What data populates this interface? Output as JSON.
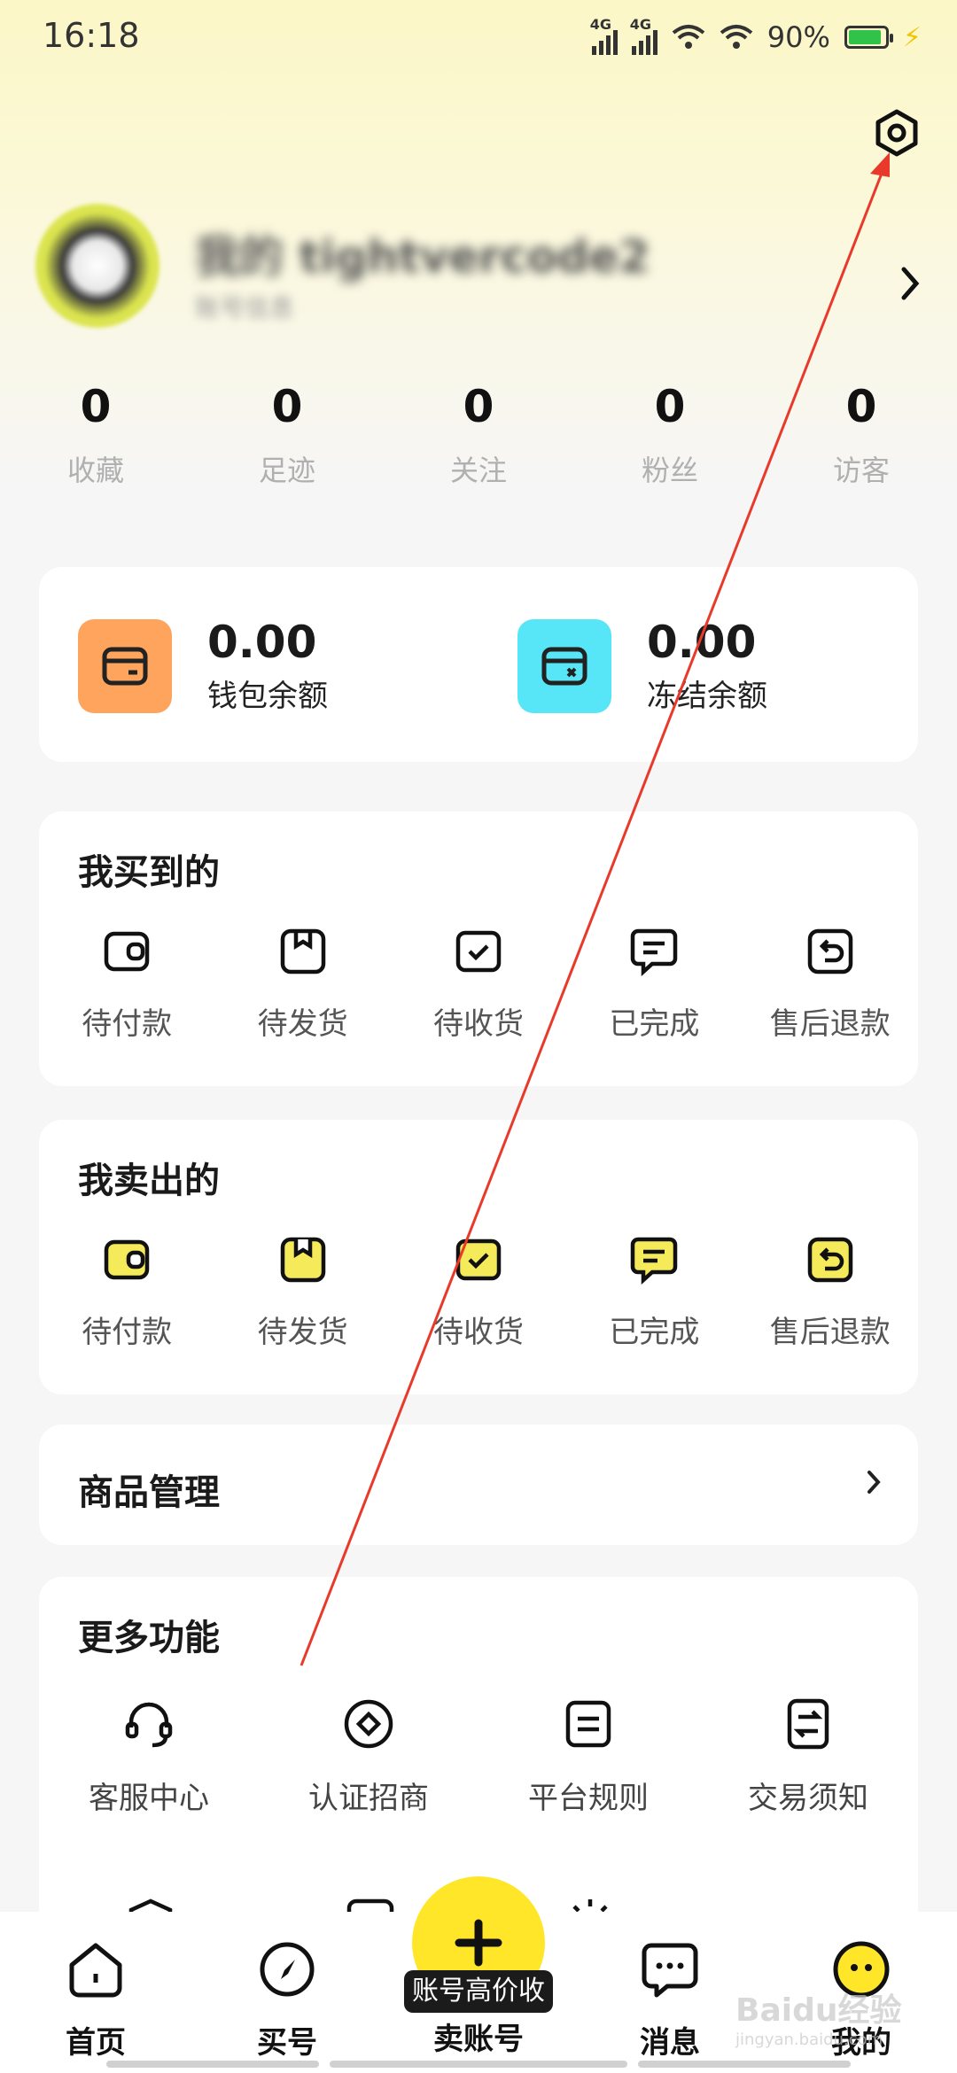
{
  "status_bar": {
    "time": "16:18",
    "battery": "90%",
    "net1": "4G",
    "net2": "4G"
  },
  "profile": {
    "username": "我的 tightvercode2",
    "subtitle": "账号信息"
  },
  "stats": [
    {
      "value": "0",
      "label": "收藏"
    },
    {
      "value": "0",
      "label": "足迹"
    },
    {
      "value": "0",
      "label": "关注"
    },
    {
      "value": "0",
      "label": "粉丝"
    },
    {
      "value": "0",
      "label": "访客"
    }
  ],
  "wallet": {
    "balance": {
      "amount": "0.00",
      "label": "钱包余额"
    },
    "frozen": {
      "amount": "0.00",
      "label": "冻结余额"
    }
  },
  "bought": {
    "title": "我买到的",
    "items": [
      "待付款",
      "待发货",
      "待收货",
      "已完成",
      "售后退款"
    ]
  },
  "sold": {
    "title": "我卖出的",
    "items": [
      "待付款",
      "待发货",
      "待收货",
      "已完成",
      "售后退款"
    ]
  },
  "goods": {
    "title": "商品管理"
  },
  "more": {
    "title": "更多功能",
    "items": [
      "客服中心",
      "认证招商",
      "平台规则",
      "交易须知"
    ]
  },
  "tabs": {
    "home": "首页",
    "buy": "买号",
    "sell": "卖账号",
    "messages": "消息",
    "mine": "我的",
    "fab_badge": "账号高价收"
  },
  "colors": {
    "accent": "#ffe629",
    "wallet_orange": "#ffa45c",
    "wallet_cyan": "#56e6f7",
    "annotation": "#e8392b"
  },
  "watermark": {
    "brand": "Baidu经验",
    "url": "jingyan.baidu.com"
  }
}
